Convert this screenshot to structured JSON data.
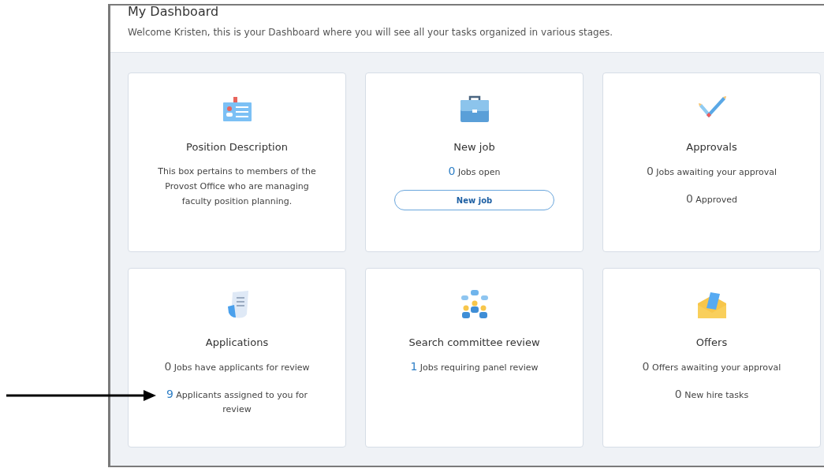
{
  "header": {
    "title": "My Dashboard",
    "subtitle": "Welcome Kristen, this is your Dashboard where you will see all your tasks organized in various stages."
  },
  "cards": [
    {
      "title": "Position Description",
      "description": "This box pertains to members of the Provost Office who are managing faculty position planning."
    },
    {
      "title": "New job",
      "stats": [
        {
          "count": "0",
          "label": "Jobs open",
          "highlighted": true
        }
      ],
      "button": "New job"
    },
    {
      "title": "Approvals",
      "stats": [
        {
          "count": "0",
          "label": "Jobs awaiting your approval",
          "highlighted": false
        },
        {
          "count": "0",
          "label": "Approved",
          "highlighted": false
        }
      ]
    },
    {
      "title": "Applications",
      "stats": [
        {
          "count": "0",
          "label": "Jobs have applicants for review",
          "highlighted": false
        },
        {
          "count": "9",
          "label": "Applicants assigned to you for review",
          "highlighted": true
        }
      ]
    },
    {
      "title": "Search committee review",
      "stats": [
        {
          "count": "1",
          "label": "Jobs requiring panel review",
          "highlighted": true
        }
      ]
    },
    {
      "title": "Offers",
      "stats": [
        {
          "count": "0",
          "label": "Offers awaiting your approval",
          "highlighted": false
        },
        {
          "count": "0",
          "label": "New hire tasks",
          "highlighted": false
        }
      ]
    }
  ]
}
